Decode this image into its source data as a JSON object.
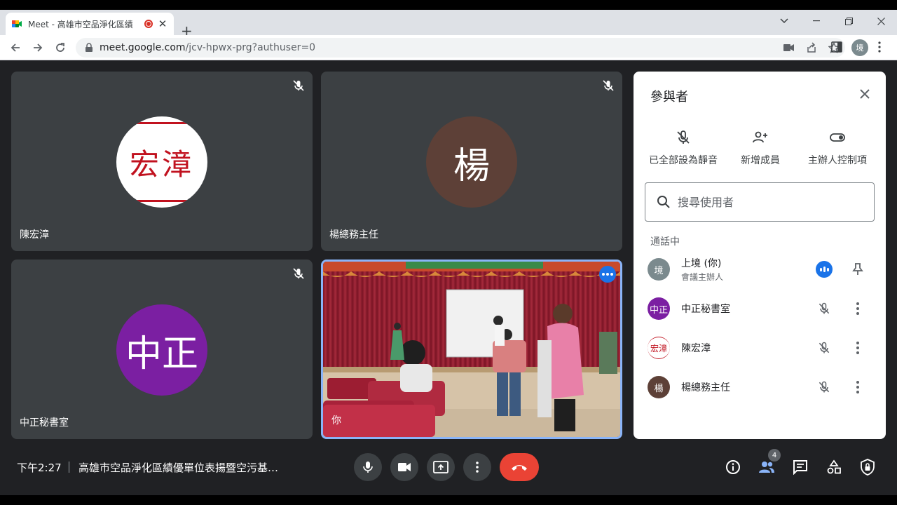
{
  "browser": {
    "tab_title": "Meet - 高雄市空品淨化區績",
    "tab_close": "✕",
    "new_tab": "+",
    "url_host": "meet.google.com",
    "url_path": "/jcv-hpwx-prg?authuser=0",
    "profile_initial": "境"
  },
  "tiles": [
    {
      "name": "陳宏漳",
      "avatar_text": "宏漳"
    },
    {
      "name": "楊總務主任",
      "avatar_text": "楊"
    },
    {
      "name": "中正秘書室",
      "avatar_text": "中正"
    },
    {
      "name": "你"
    }
  ],
  "colors": {
    "avatar_yang": "#5d4037",
    "avatar_zhongzheng": "#7b1fa2",
    "avatar_self": "#7b8a8e",
    "end_call": "#ea4335",
    "accent": "#1a73e8"
  },
  "panel": {
    "title": "參與者",
    "actions": [
      {
        "label": "已全部設為靜音",
        "icon": "mic-off-icon"
      },
      {
        "label": "新增成員",
        "icon": "person-add-icon"
      },
      {
        "label": "主辦人控制項",
        "icon": "toggle-icon"
      }
    ],
    "search_placeholder": "搜尋使用者",
    "section_label": "通話中",
    "participants": [
      {
        "name": "上境 (你)",
        "role": "會議主辦人",
        "avatar": "境"
      },
      {
        "name": "中正秘書室",
        "avatar": "中正"
      },
      {
        "name": "陳宏漳",
        "avatar": "宏漳"
      },
      {
        "name": "楊總務主任",
        "avatar": "楊"
      }
    ]
  },
  "bottom": {
    "time": "下午2:27",
    "meeting_title": "高雄市空品淨化區績優單位表揚暨空污基…",
    "people_count": "4"
  }
}
